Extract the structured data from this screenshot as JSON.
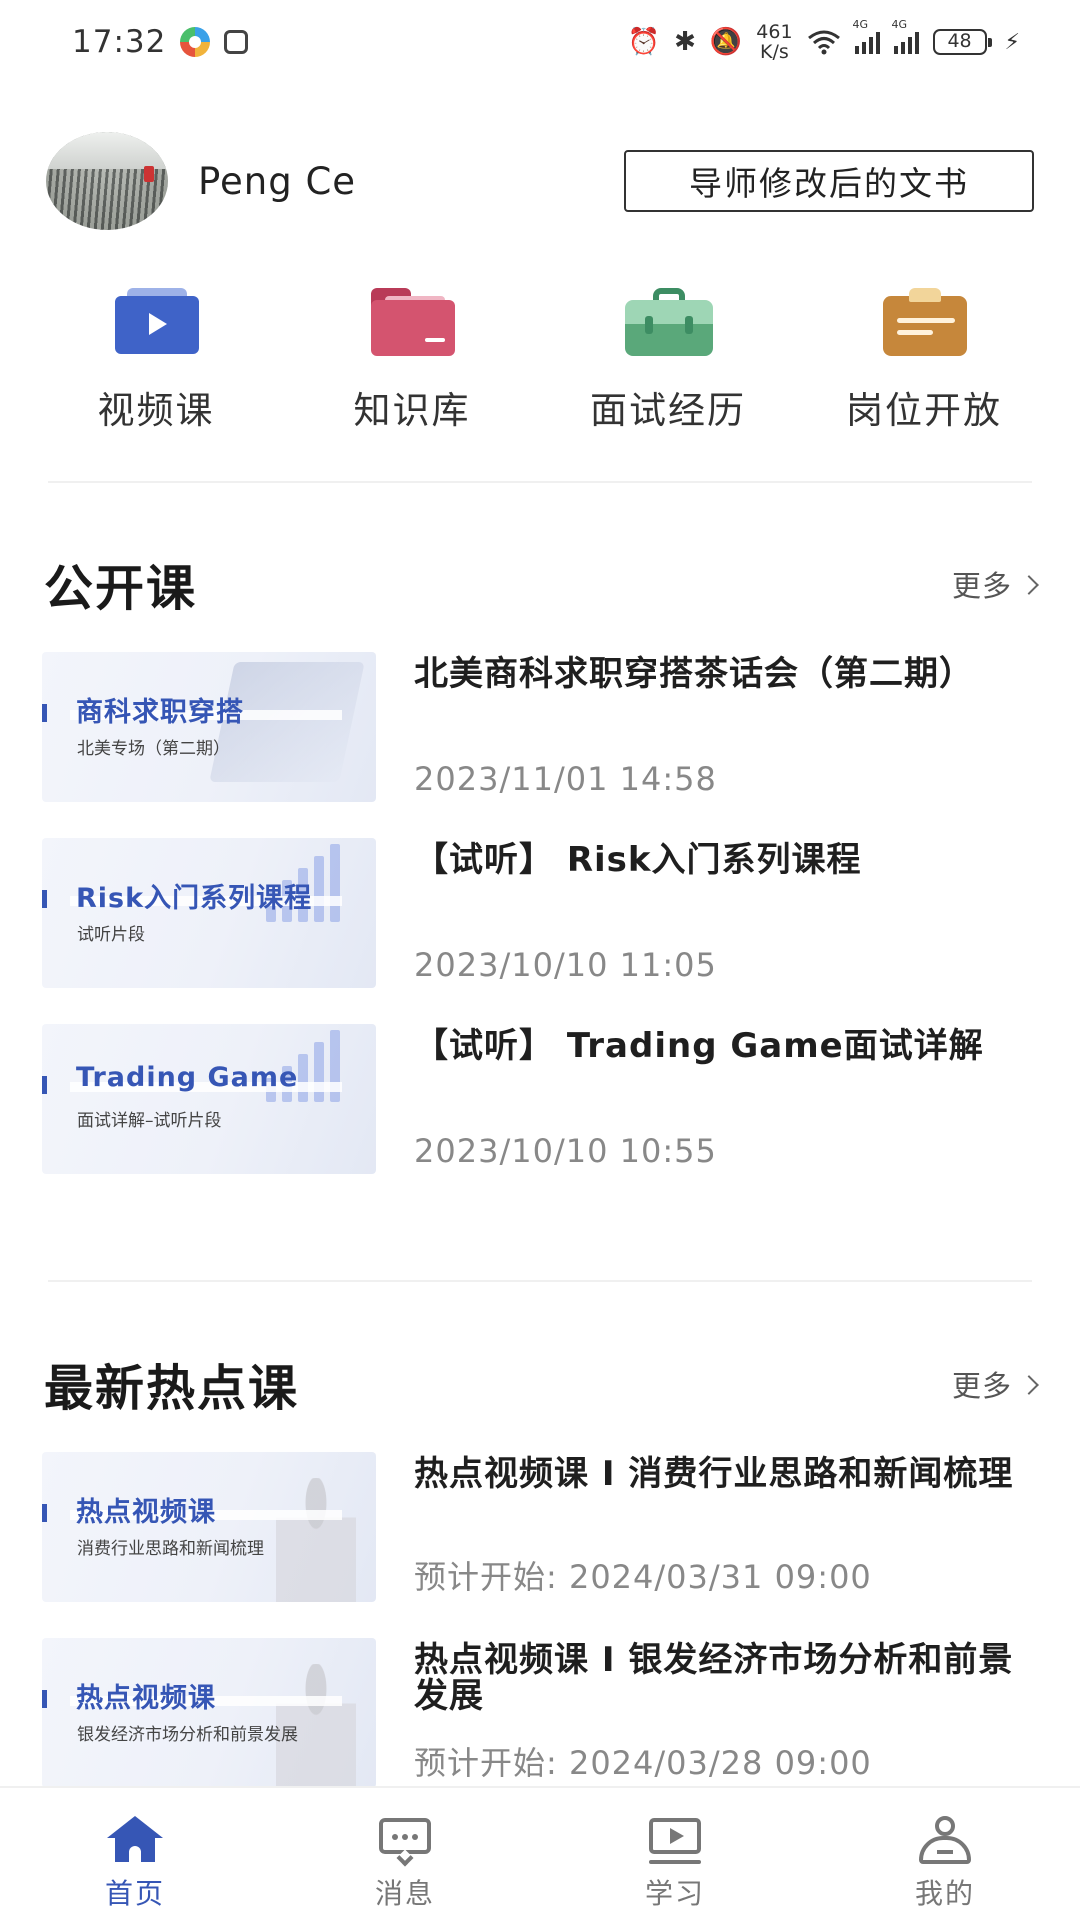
{
  "status_bar": {
    "time": "17:32",
    "speed_value": "461",
    "speed_unit": "K/s",
    "network_1": "4G",
    "network_2": "4G",
    "battery": "48",
    "icons": [
      "alarm-icon",
      "bluetooth-icon",
      "mute-icon",
      "wifi-icon",
      "signal-icon",
      "charging-icon"
    ]
  },
  "profile": {
    "name": "Peng Ce",
    "doc_button_label": "导师修改后的文书"
  },
  "quick_nav": [
    {
      "label": "视频课",
      "icon": "video-icon",
      "color": "#3f63c8"
    },
    {
      "label": "知识库",
      "icon": "folder-icon",
      "color": "#d4546f"
    },
    {
      "label": "面试经历",
      "icon": "briefcase-icon",
      "color": "#5aa87a"
    },
    {
      "label": "岗位开放",
      "icon": "clipboard-icon",
      "color": "#c6873b"
    }
  ],
  "open_courses": {
    "title": "公开课",
    "more": "更多",
    "items": [
      {
        "thumb_title": "商科求职穿搭",
        "thumb_sub": "北美专场（第二期）",
        "title": "北美商科求职穿搭茶话会（第二期）",
        "date": "2023/11/01 14:58"
      },
      {
        "thumb_title": "Risk入门系列课程",
        "thumb_sub": "试听片段",
        "title": "【试听】 Risk入门系列课程",
        "date": "2023/10/10 11:05"
      },
      {
        "thumb_title": "Trading Game",
        "thumb_sub": "面试详解–试听片段",
        "title": "【试听】 Trading Game面试详解",
        "date": "2023/10/10 10:55"
      }
    ]
  },
  "hot_courses": {
    "title": "最新热点课",
    "more": "更多",
    "items": [
      {
        "thumb_title": "热点视频课",
        "thumb_sub": "消费行业思路和新闻梳理",
        "title": "热点视频课 I 消费行业思路和新闻梳理",
        "date": "预计开始: 2024/03/31 09:00"
      },
      {
        "thumb_title": "热点视频课",
        "thumb_sub": "银发经济市场分析和前景发展",
        "title": "热点视频课 I 银发经济市场分析和前景发展",
        "date": "预计开始: 2024/03/28 09:00"
      }
    ]
  },
  "tab_bar": [
    {
      "label": "首页",
      "icon": "home-icon",
      "active": true
    },
    {
      "label": "消息",
      "icon": "message-icon",
      "active": false
    },
    {
      "label": "学习",
      "icon": "learn-icon",
      "active": false
    },
    {
      "label": "我的",
      "icon": "profile-icon",
      "active": false
    }
  ],
  "accent_color": "#3656b5"
}
